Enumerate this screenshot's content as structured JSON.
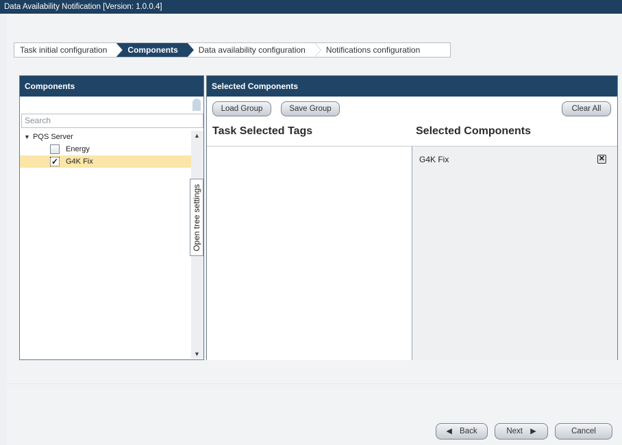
{
  "window": {
    "title": "Data Availability Notification [Version: 1.0.0.4]"
  },
  "wizard": {
    "steps": [
      {
        "label": "Task initial configuration",
        "active": false
      },
      {
        "label": "Components",
        "active": true
      },
      {
        "label": "Data availability configuration",
        "active": false
      },
      {
        "label": "Notifications configuration",
        "active": false
      }
    ]
  },
  "components_panel": {
    "header": "Components",
    "search_placeholder": "Search",
    "tree": {
      "root": "PQS Server",
      "children": [
        {
          "label": "Energy",
          "checked": false
        },
        {
          "label": "G4K Fix",
          "checked": true
        }
      ]
    },
    "tree_settings_label": "Open tree settings"
  },
  "selected_panel": {
    "header": "Selected Components",
    "load_group": "Load Group",
    "save_group": "Save Group",
    "clear_all": "Clear All",
    "task_tags_title": "Task Selected Tags",
    "selected_title": "Selected Components",
    "selected_items": [
      "G4K Fix"
    ]
  },
  "footer": {
    "back": "Back",
    "next": "Next",
    "cancel": "Cancel"
  },
  "colors": {
    "header_bg": "#1f4466",
    "title_bg": "#1d3f60",
    "selection_bg": "#fbe6a8"
  }
}
